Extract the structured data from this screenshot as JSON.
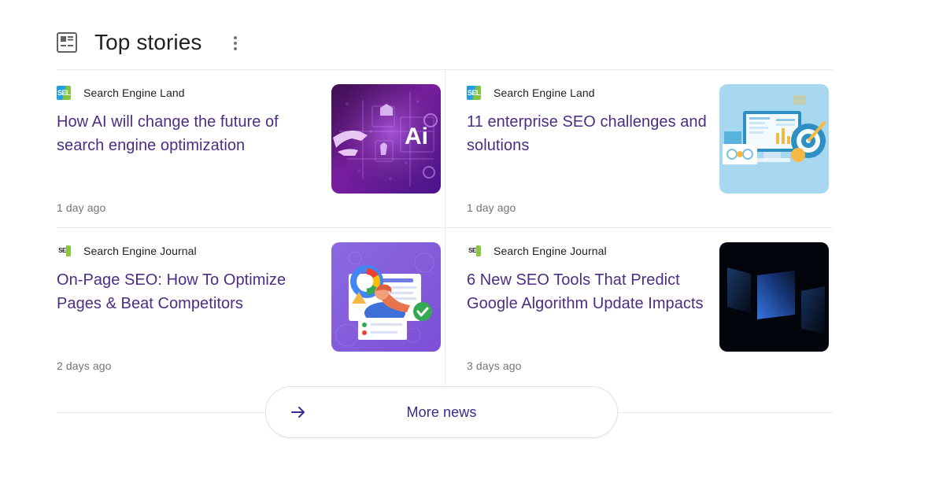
{
  "header": {
    "title": "Top stories",
    "icon": "news-article-icon",
    "menu_icon": "overflow-menu-icon"
  },
  "stories": [
    {
      "source": "Search Engine Land",
      "favicon_text": "SEL",
      "favicon_kind": "sel",
      "headline": "How AI will change the future of search engine optimization",
      "timestamp": "1 day ago",
      "thumbnail": "ai-circuit-purple-thumbnail"
    },
    {
      "source": "Search Engine Land",
      "favicon_text": "SEL",
      "favicon_kind": "sel",
      "headline": "11 enterprise SEO challenges and solutions",
      "timestamp": "1 day ago",
      "thumbnail": "dashboard-target-blue-thumbnail"
    },
    {
      "source": "Search Engine Journal",
      "favicon_text": "SE",
      "favicon_kind": "sej",
      "headline": "On-Page SEO: How To Optimize Pages & Beat Competitors",
      "timestamp": "2 days ago",
      "thumbnail": "on-page-seo-purple-thumbnail"
    },
    {
      "source": "Search Engine Journal",
      "favicon_text": "SE",
      "favicon_kind": "sej",
      "headline": "6 New SEO Tools That Predict Google Algorithm Update Impacts",
      "timestamp": "3 days ago",
      "thumbnail": "dark-blue-panels-thumbnail"
    }
  ],
  "footer": {
    "more_news_label": "More news",
    "more_news_icon": "arrow-right-icon"
  },
  "colors": {
    "headline_link": "#4b2e83",
    "title_text": "#202124",
    "muted_text": "#70757a",
    "divider": "#ebebeb",
    "more_news_text": "#3b2a8c"
  }
}
